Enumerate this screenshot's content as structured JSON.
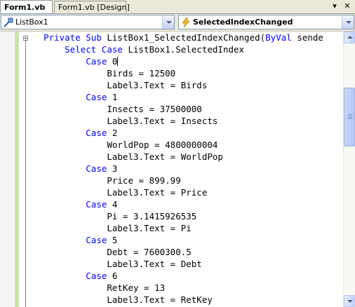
{
  "tabs": [
    {
      "label": "Form1.vb",
      "active": true
    },
    {
      "label": "Form1.vb [Design]",
      "active": false
    }
  ],
  "tab_controls": {
    "dropdown_glyph": "▾",
    "close_glyph": "✕"
  },
  "navbar": {
    "class_combo": {
      "value": "ListBox1",
      "icon": "control-icon"
    },
    "method_combo": {
      "value": "SelectedIndexChanged",
      "icon": "event-lightning-icon"
    }
  },
  "code_lines": [
    {
      "indent": 1,
      "segments": [
        {
          "t": "Private Sub ",
          "kw": true
        },
        {
          "t": "ListBox1_SelectedIndexChanged(",
          "kw": false
        },
        {
          "t": "ByVal",
          "kw": true
        },
        {
          "t": " sende",
          "kw": false
        }
      ]
    },
    {
      "indent": 2,
      "segments": [
        {
          "t": "Select Case",
          "kw": true
        },
        {
          "t": " ListBox1.SelectedIndex",
          "kw": false
        }
      ]
    },
    {
      "indent": 3,
      "segments": [
        {
          "t": "Case",
          "kw": true
        },
        {
          "t": " 0",
          "kw": false
        }
      ],
      "caret": true
    },
    {
      "indent": 4,
      "segments": [
        {
          "t": "Birds = 12500",
          "kw": false
        }
      ]
    },
    {
      "indent": 4,
      "segments": [
        {
          "t": "Label3.Text = Birds",
          "kw": false
        }
      ]
    },
    {
      "indent": 3,
      "segments": [
        {
          "t": "Case",
          "kw": true
        },
        {
          "t": " 1",
          "kw": false
        }
      ]
    },
    {
      "indent": 4,
      "segments": [
        {
          "t": "Insects = 37500000",
          "kw": false
        }
      ]
    },
    {
      "indent": 4,
      "segments": [
        {
          "t": "Label3.Text = Insects",
          "kw": false
        }
      ]
    },
    {
      "indent": 3,
      "segments": [
        {
          "t": "Case",
          "kw": true
        },
        {
          "t": " 2",
          "kw": false
        }
      ]
    },
    {
      "indent": 4,
      "segments": [
        {
          "t": "WorldPop = 4800000004",
          "kw": false
        }
      ]
    },
    {
      "indent": 4,
      "segments": [
        {
          "t": "Label3.Text = WorldPop",
          "kw": false
        }
      ]
    },
    {
      "indent": 3,
      "segments": [
        {
          "t": "Case",
          "kw": true
        },
        {
          "t": " 3",
          "kw": false
        }
      ]
    },
    {
      "indent": 4,
      "segments": [
        {
          "t": "Price = 899.99",
          "kw": false
        }
      ]
    },
    {
      "indent": 4,
      "segments": [
        {
          "t": "Label3.Text = Price",
          "kw": false
        }
      ]
    },
    {
      "indent": 3,
      "segments": [
        {
          "t": "Case",
          "kw": true
        },
        {
          "t": " 4",
          "kw": false
        }
      ]
    },
    {
      "indent": 4,
      "segments": [
        {
          "t": "Pi = 3.1415926535",
          "kw": false
        }
      ]
    },
    {
      "indent": 4,
      "segments": [
        {
          "t": "Label3.Text = Pi",
          "kw": false
        }
      ]
    },
    {
      "indent": 3,
      "segments": [
        {
          "t": "Case",
          "kw": true
        },
        {
          "t": " 5",
          "kw": false
        }
      ]
    },
    {
      "indent": 4,
      "segments": [
        {
          "t": "Debt = 7600300.5",
          "kw": false
        }
      ]
    },
    {
      "indent": 4,
      "segments": [
        {
          "t": "Label3.Text = Debt",
          "kw": false
        }
      ]
    },
    {
      "indent": 3,
      "segments": [
        {
          "t": "Case",
          "kw": true
        },
        {
          "t": " 6",
          "kw": false
        }
      ]
    },
    {
      "indent": 4,
      "segments": [
        {
          "t": "RetKey = 13",
          "kw": false
        }
      ]
    },
    {
      "indent": 4,
      "segments": [
        {
          "t": "Label3.Text = RetKey",
          "kw": false
        }
      ]
    }
  ],
  "colors": {
    "keyword": "#0000ff",
    "text": "#000000",
    "change_bar": "#c1e9a6"
  },
  "scrollbar": {
    "position_fraction": 0.23
  }
}
